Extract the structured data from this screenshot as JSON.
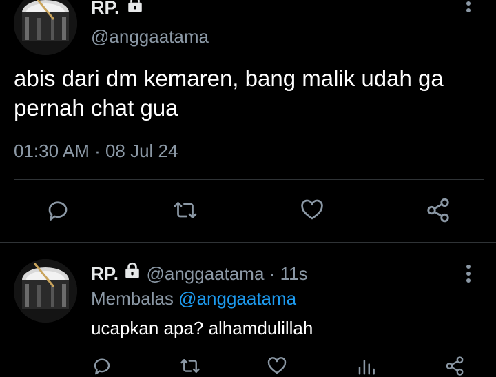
{
  "main_tweet": {
    "display_name": "RP.",
    "handle": "@anggaatama",
    "text": "abis dari dm kemaren, bang malik udah ga pernah chat gua",
    "timestamp": "01:30 AM · 08 Jul 24",
    "actions": [
      "reply-icon",
      "retweet-icon",
      "like-icon",
      "share-icon"
    ]
  },
  "reply_tweet": {
    "display_name": "RP.",
    "handle": "@anggaatama",
    "separator": "·",
    "time_ago": "11s",
    "replying_prefix": "Membalas",
    "replying_to": "@anggaatama",
    "text": "ucapkan apa? alhamdulillah",
    "actions": [
      "reply-icon",
      "retweet-icon",
      "like-icon",
      "views-icon",
      "share-icon"
    ]
  },
  "colors": {
    "background": "#000000",
    "text_primary": "#e7e9ea",
    "text_secondary": "#8b98a5",
    "link": "#1d9bf0",
    "divider": "#2f3336"
  }
}
